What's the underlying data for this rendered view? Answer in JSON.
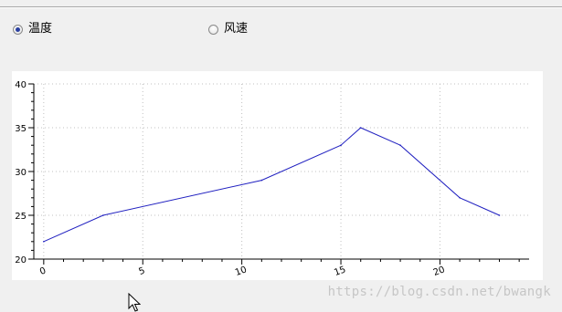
{
  "radios": [
    {
      "label": "温度",
      "checked": true
    },
    {
      "label": "风速",
      "checked": false
    }
  ],
  "watermark": "https://blog.csdn.net/bwangk",
  "chart_data": {
    "type": "line",
    "title": "",
    "xlabel": "",
    "ylabel": "",
    "xlim": [
      -0.5,
      24.5
    ],
    "ylim": [
      20,
      40
    ],
    "xticks": [
      0,
      5,
      10,
      15,
      20
    ],
    "yticks": [
      20,
      25,
      30,
      35,
      40
    ],
    "grid": true,
    "line_color": "#2020c0",
    "series": [
      {
        "x": [
          0,
          3,
          11,
          15,
          16,
          18,
          21,
          23
        ],
        "y": [
          22,
          25,
          29,
          33,
          35,
          33,
          27,
          25
        ]
      }
    ]
  }
}
